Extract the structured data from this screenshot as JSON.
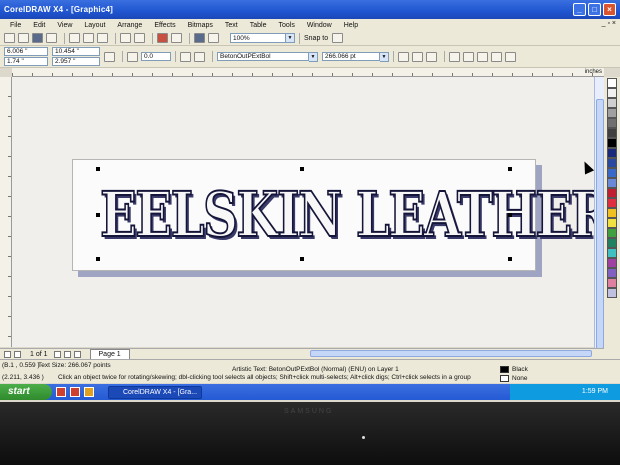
{
  "window": {
    "title": "CorelDRAW X4 - [Graphic4]",
    "minimize": "_",
    "maximize": "□",
    "close": "×"
  },
  "menu": {
    "items": [
      "File",
      "Edit",
      "View",
      "Layout",
      "Arrange",
      "Effects",
      "Bitmaps",
      "Text",
      "Table",
      "Tools",
      "Window",
      "Help"
    ],
    "right_controls": "_ ▫ ×"
  },
  "toolbar1": {
    "zoom": "100%",
    "snap_to": "Snap to"
  },
  "toolbar2": {
    "x": "6.006 \"",
    "y": "1.74 \"",
    "width": "10.454 \"",
    "height": "2.957 \"",
    "rotation": "0.0",
    "font": "BetonOutPExtBol",
    "font_size": "266.066 pt"
  },
  "ruler": {
    "unit": "inches"
  },
  "canvas": {
    "artistic_text": "EELSKIN LEATHER"
  },
  "navigation": {
    "page_count": "1 of 1",
    "page_tab": "Page 1"
  },
  "status": {
    "coords": "(B.1 , 0.559 )",
    "text_size": "Text Size: 266.067 points",
    "position2": "(2.211, 3.436 )",
    "hint": "Click an object twice for rotating/skewing; dbl-clicking tool selects all objects; Shift+click multi-selects; Alt+click digs; Ctrl+click selects in a group",
    "artistic": "Artistic Text: BetonOutPExtBol (Normal) (ENU) on Layer 1",
    "fill_label": "Black",
    "outline_label": "None"
  },
  "taskbar": {
    "start": "start",
    "task": "CorelDRAW X4 - [Gra...",
    "clock": "1:59 PM"
  },
  "monitor": {
    "brand": "SAMSUNG"
  },
  "palette_colors": [
    "#ffffff",
    "#f0f0f0",
    "#d0d0d0",
    "#a0a0a0",
    "#707070",
    "#404040",
    "#000000",
    "#1a2a7a",
    "#2a4aa0",
    "#3a6ac8",
    "#6a8ad8",
    "#c02030",
    "#e03040",
    "#f0c020",
    "#f0e040",
    "#40a040",
    "#208060",
    "#40c0c0",
    "#a040a0",
    "#8060c0",
    "#e080a0",
    "#c0c0e0"
  ]
}
